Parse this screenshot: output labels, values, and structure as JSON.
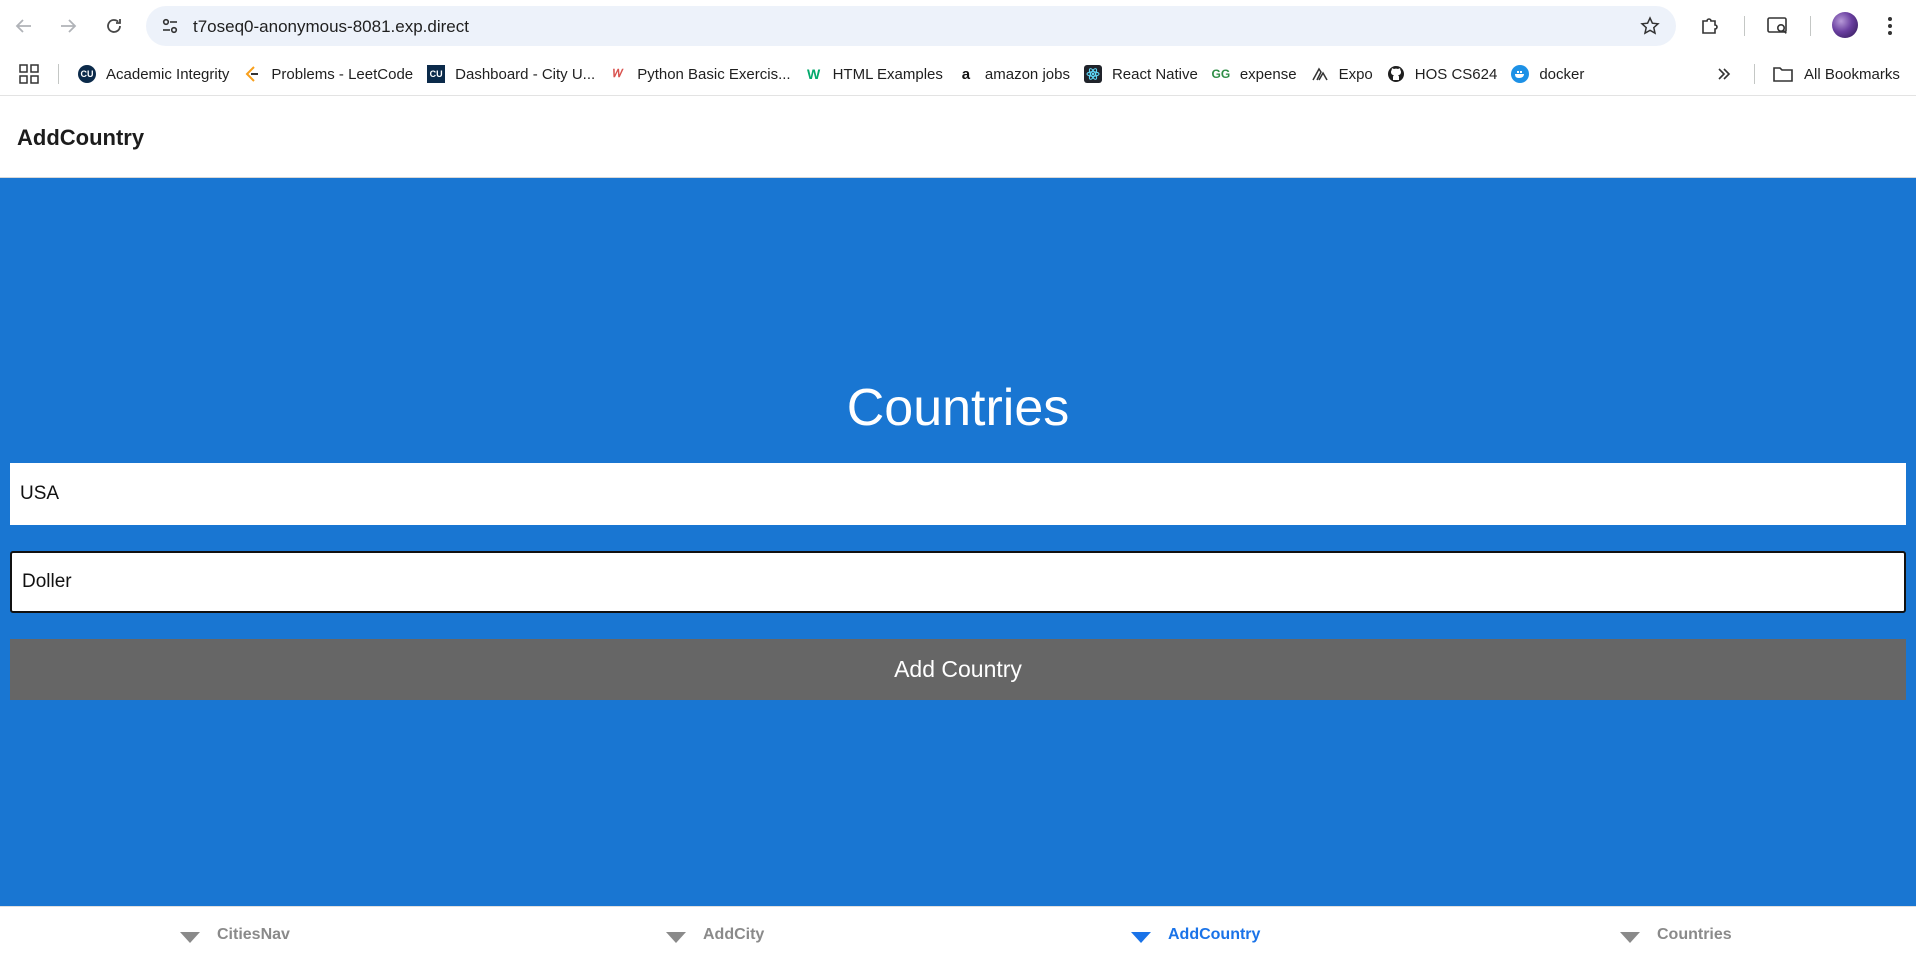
{
  "browser": {
    "url": "t7oseq0-anonymous-8081.exp.direct",
    "bookmarks": [
      {
        "label": "Academic Integrity",
        "icon": "cu-logo-icon"
      },
      {
        "label": "Problems - LeetCode",
        "icon": "leetcode-icon"
      },
      {
        "label": "Dashboard - City U...",
        "icon": "cu-square-icon"
      },
      {
        "label": "Python Basic Exercis...",
        "icon": "w3resource-icon"
      },
      {
        "label": "HTML Examples",
        "icon": "w3schools-icon"
      },
      {
        "label": "amazon jobs",
        "icon": "amazon-icon"
      },
      {
        "label": "React Native",
        "icon": "react-icon"
      },
      {
        "label": "expense",
        "icon": "geeksforgeeks-icon"
      },
      {
        "label": "Expo",
        "icon": "expo-icon"
      },
      {
        "label": "HOS CS624",
        "icon": "github-icon"
      },
      {
        "label": "docker",
        "icon": "docker-icon"
      }
    ],
    "all_bookmarks_label": "All Bookmarks"
  },
  "app": {
    "header_title": "AddCountry",
    "heading": "Countries",
    "country_name_value": "USA",
    "currency_value": "Doller",
    "add_button_label": "Add Country",
    "colors": {
      "background": "#1976d2",
      "button": "#666666",
      "active_tab": "#1a73e8"
    }
  },
  "tabs": [
    {
      "label": "CitiesNav",
      "active": false
    },
    {
      "label": "AddCity",
      "active": false
    },
    {
      "label": "AddCountry",
      "active": true
    },
    {
      "label": "Countries",
      "active": false
    }
  ]
}
